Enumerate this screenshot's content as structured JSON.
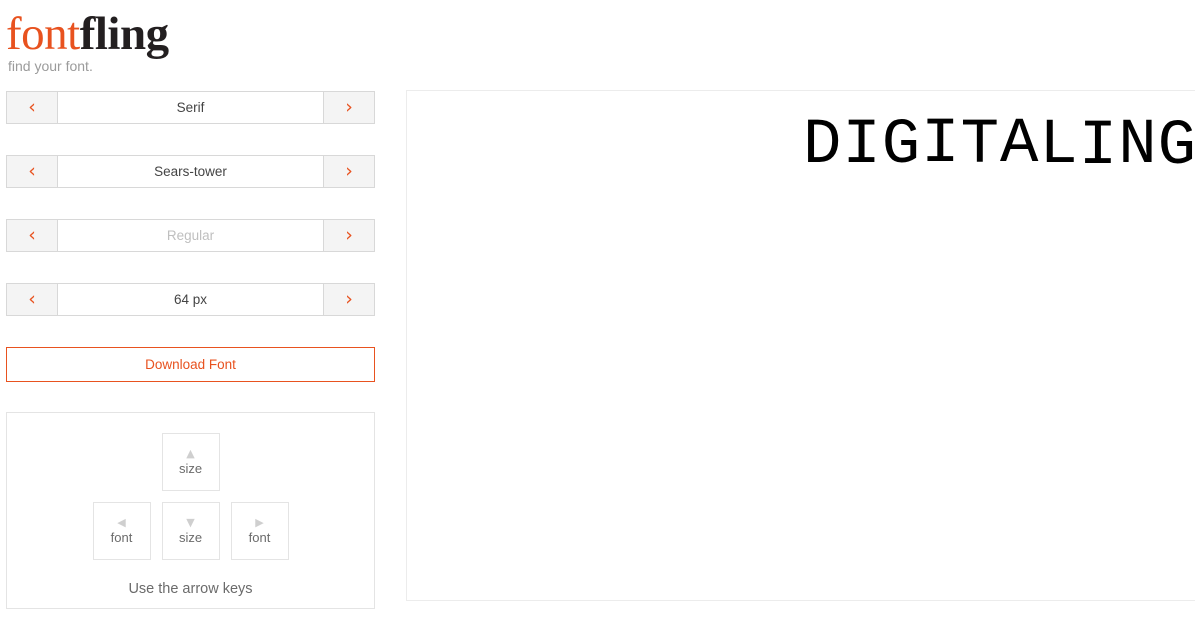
{
  "brand": {
    "name_part1": "font",
    "name_part2": "fling",
    "tagline": "find your font.",
    "accent_color": "#e8521f",
    "dark_color": "#231f20"
  },
  "controls": {
    "prev_icon": "‹",
    "next_icon": "›",
    "rows": [
      {
        "name": "category",
        "value": "Serif",
        "muted": false
      },
      {
        "name": "font",
        "value": "Sears-tower",
        "muted": false
      },
      {
        "name": "weight",
        "value": "Regular",
        "muted": true
      },
      {
        "name": "size",
        "value": "64 px",
        "muted": false
      }
    ],
    "download_label": "Download Font"
  },
  "hint": {
    "keys": [
      {
        "position": "up",
        "glyph": "▲",
        "label": "size"
      },
      {
        "position": "left",
        "glyph": "◀",
        "label": "font"
      },
      {
        "position": "down",
        "glyph": "▼",
        "label": "size"
      },
      {
        "position": "right",
        "glyph": "▶",
        "label": "font"
      }
    ],
    "caption": "Use the arrow keys"
  },
  "preview": {
    "text": "DIGITALING",
    "font_size_px": 64
  }
}
